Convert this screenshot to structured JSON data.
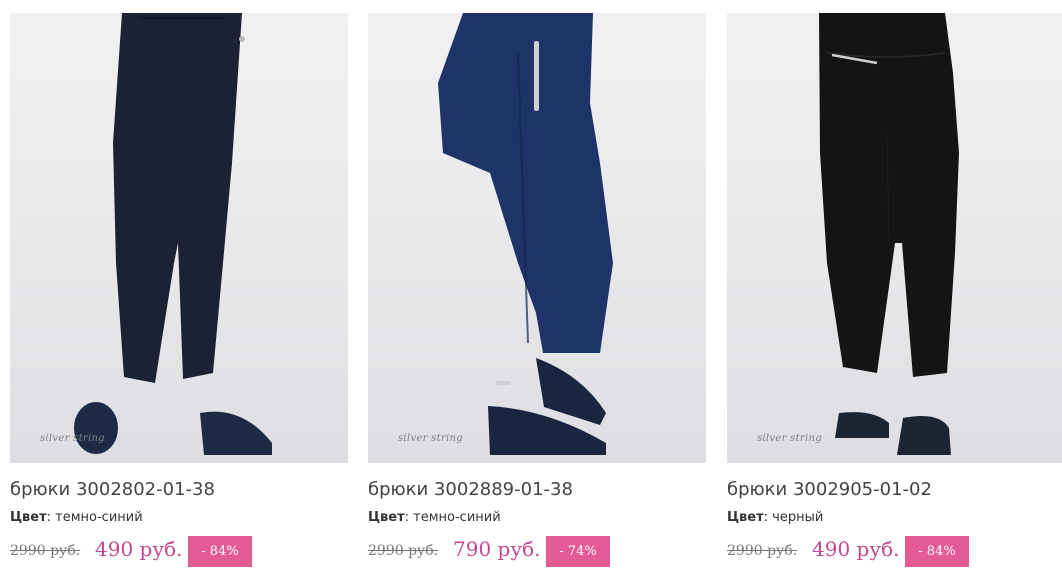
{
  "products": [
    {
      "title": "брюки 3002802-01-38",
      "color_label": "Цвет",
      "color_value": "темно-синий",
      "old_price": "2990 руб.",
      "new_price": "490 руб.",
      "discount": "- 84%",
      "brand_mark": "silver string",
      "pants_color": "#1c2233",
      "shoe_color": "#1d2a44"
    },
    {
      "title": "брюки 3002889-01-38",
      "color_label": "Цвет",
      "color_value": "темно-синий",
      "old_price": "2990 руб.",
      "new_price": "790 руб.",
      "discount": "- 74%",
      "brand_mark": "silver string",
      "pants_color": "#1e3468",
      "shoe_color": "#1a2540"
    },
    {
      "title": "брюки 3002905-01-02",
      "color_label": "Цвет",
      "color_value": "черный",
      "old_price": "2990 руб.",
      "new_price": "490 руб.",
      "discount": "- 84%",
      "brand_mark": "silver string",
      "pants_color": "#141414",
      "shoe_color": "#1d2535"
    }
  ],
  "colors": {
    "price": "#c2478f",
    "badge_bg": "#e45a97",
    "photo_bg": "#ececef"
  }
}
